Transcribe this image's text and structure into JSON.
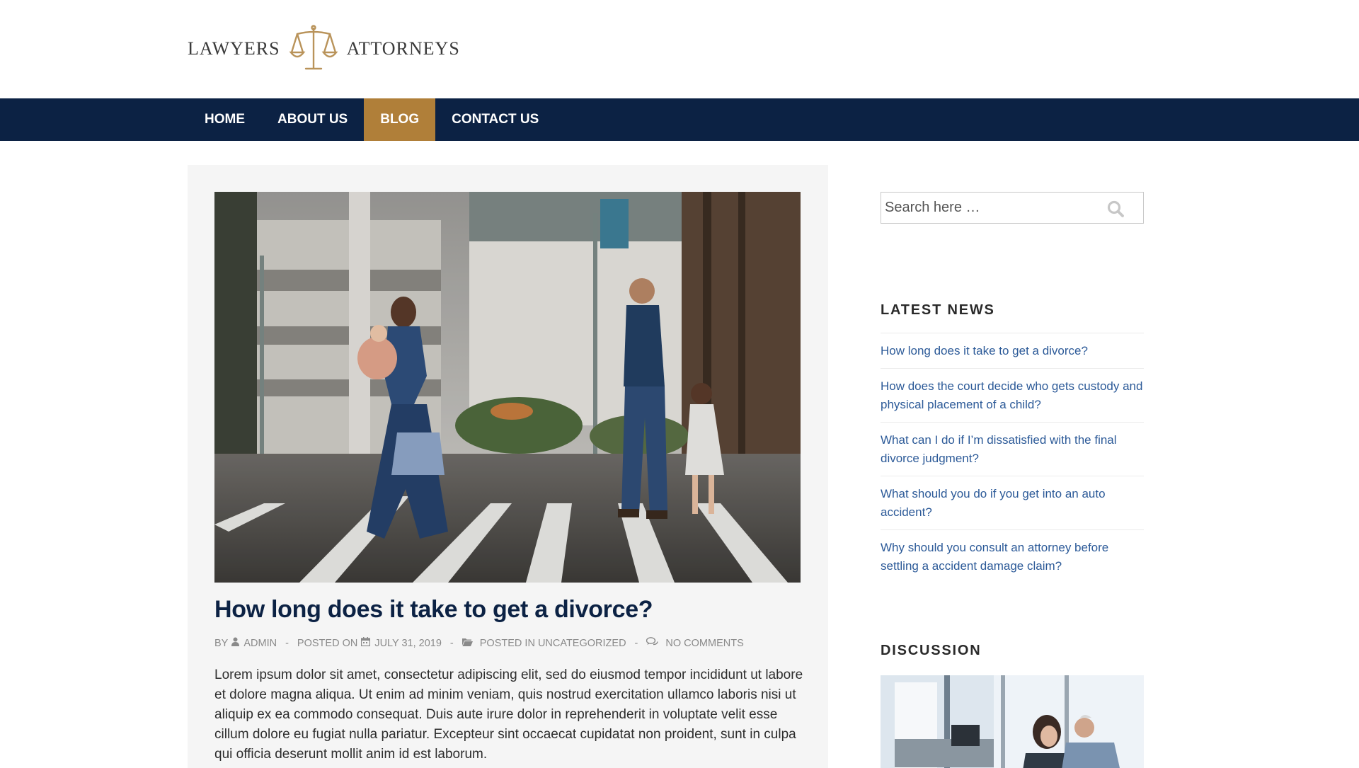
{
  "header": {
    "logo_left": "LAWYERS",
    "logo_right": "ATTORNEYS",
    "logo_color": "#b9935a"
  },
  "nav": {
    "items": [
      {
        "label": "HOME",
        "active": false
      },
      {
        "label": "ABOUT US",
        "active": false
      },
      {
        "label": "BLOG",
        "active": true
      },
      {
        "label": "CONTACT US",
        "active": false
      }
    ],
    "bg_color": "#0c2244",
    "active_color": "#b07f39"
  },
  "post": {
    "title": "How long does it take to get a divorce?",
    "meta": {
      "by_label": "BY",
      "author": "ADMIN",
      "posted_on_label": "POSTED ON",
      "date": "JULY 31, 2019",
      "posted_in_label": "POSTED IN UNCATEGORIZED",
      "comments": "NO COMMENTS",
      "separator": "-"
    },
    "excerpt": "Lorem ipsum dolor sit amet, consectetur adipiscing elit, sed do eiusmod tempor incididunt ut labore et dolore magna aliqua. Ut enim ad minim veniam, quis nostrud exercitation ullamco laboris nisi ut aliquip ex ea commodo consequat. Duis aute irure dolor in reprehenderit in voluptate velit esse cillum dolore eu fugiat nulla pariatur. Excepteur sint occaecat cupidatat non proident, sunt in culpa qui officia deserunt mollit anim id est laborum."
  },
  "sidebar": {
    "search_placeholder": "Search here …",
    "latest_news": {
      "title": "LATEST NEWS",
      "items": [
        "How long does it take to get a divorce?",
        "How does the court decide who gets custody and physical placement of a child?",
        "What can I do if I’m dissatisfied with the final divorce judgment?",
        "What should you do if you get into an auto accident?",
        "Why should you consult an attorney before settling a accident damage claim?"
      ]
    },
    "discussion": {
      "title": "DISCUSSION"
    }
  },
  "colors": {
    "title": "#0c2244",
    "link": "#2c5a98"
  }
}
